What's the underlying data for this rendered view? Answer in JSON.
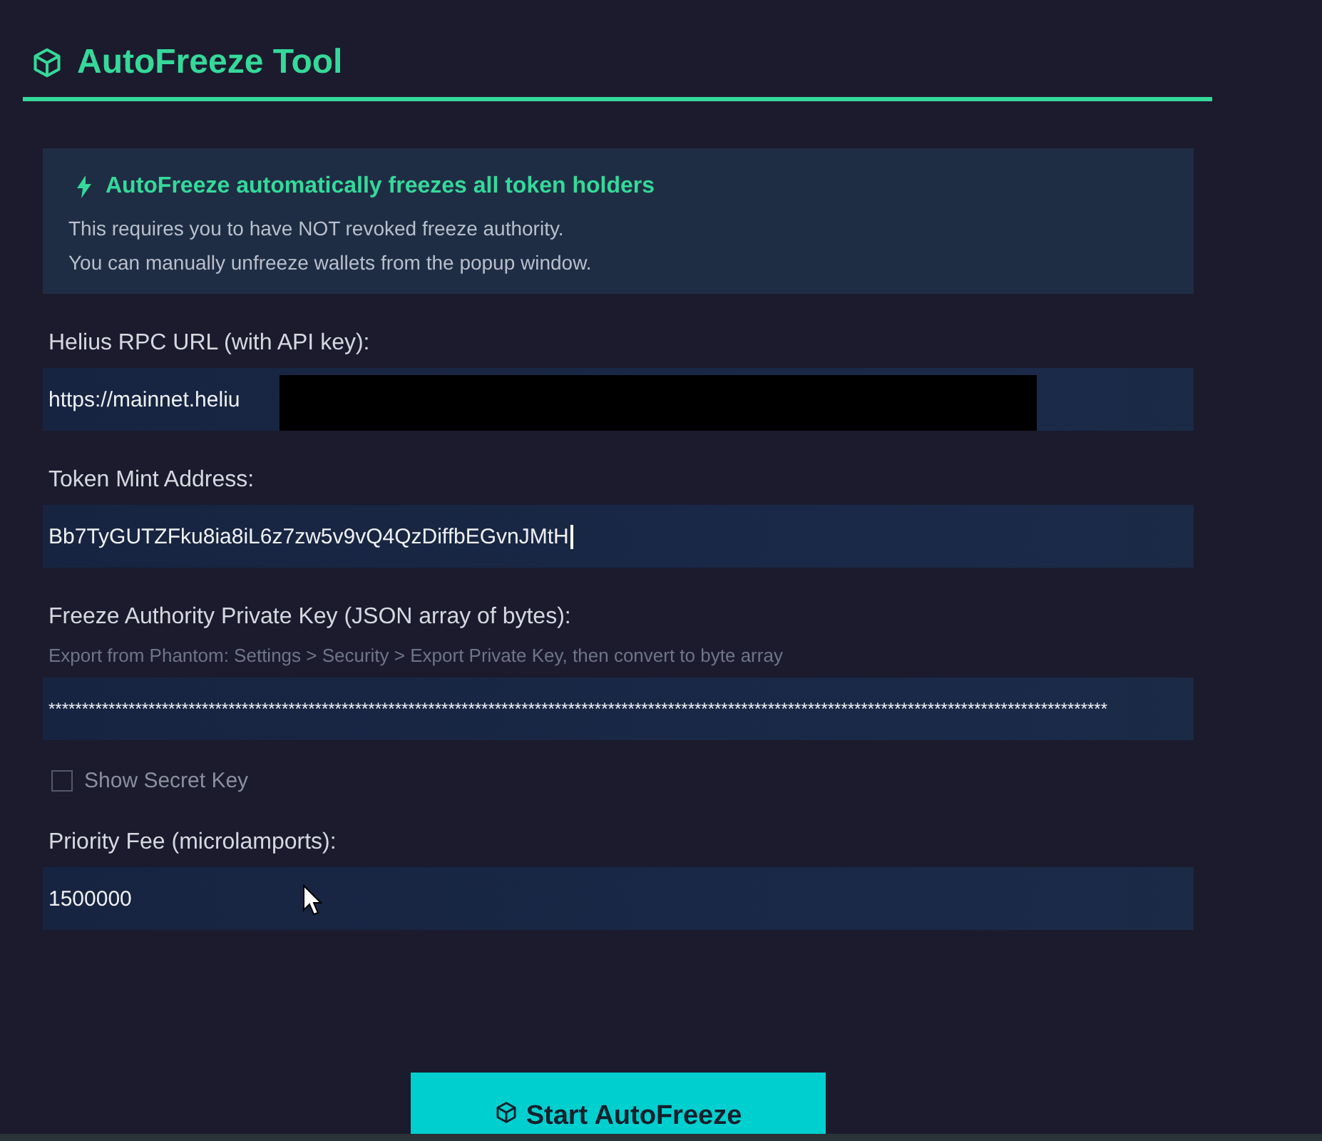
{
  "header": {
    "title": "AutoFreeze Tool"
  },
  "info": {
    "title": "AutoFreeze automatically freezes all token holders",
    "lines": [
      "This requires you to have NOT revoked freeze authority.",
      "You can manually unfreeze wallets from the popup window."
    ]
  },
  "fields": [
    {
      "kind": "text",
      "label": "Helius RPC URL (with API key):",
      "value": "https://mainnet.heliu",
      "redacted": true
    },
    {
      "kind": "text",
      "label": "Token Mint Address:",
      "value": "Bb7TyGUTZFku8ia8iL6z7zw5v9vQ4QzDiffbEGvnJMtH",
      "focused": true
    },
    {
      "kind": "secret",
      "label": "Freeze Authority Private Key (JSON array of bytes):",
      "hint": "Export from Phantom: Settings > Security > Export Private Key, then convert to byte array",
      "value": "***************************************************************************************************************************************************************"
    },
    {
      "kind": "checkbox",
      "label": "Show Secret Key",
      "checked": false
    },
    {
      "kind": "text",
      "label": "Priority Fee (microlamports):",
      "value": "1500000"
    }
  ],
  "button": {
    "label": "Start AutoFreeze"
  }
}
